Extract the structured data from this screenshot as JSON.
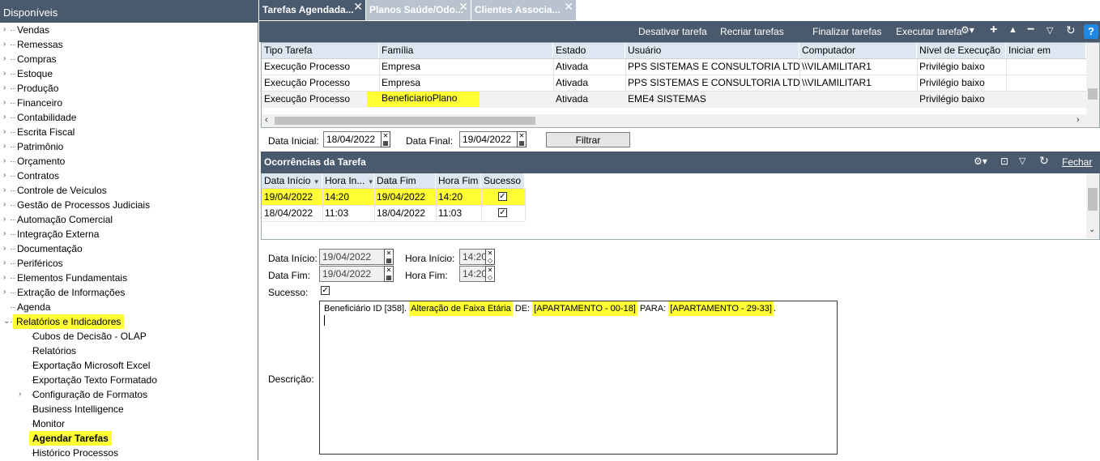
{
  "sidebar": {
    "title": "Disponíveis",
    "items": [
      {
        "label": "Vendas",
        "level": 0,
        "expandable": true
      },
      {
        "label": "Remessas",
        "level": 0,
        "expandable": true
      },
      {
        "label": "Compras",
        "level": 0,
        "expandable": true
      },
      {
        "label": "Estoque",
        "level": 0,
        "expandable": true
      },
      {
        "label": "Produção",
        "level": 0,
        "expandable": true
      },
      {
        "label": "Financeiro",
        "level": 0,
        "expandable": true
      },
      {
        "label": "Contabilidade",
        "level": 0,
        "expandable": true
      },
      {
        "label": "Escrita Fiscal",
        "level": 0,
        "expandable": true
      },
      {
        "label": "Patrimônio",
        "level": 0,
        "expandable": true
      },
      {
        "label": "Orçamento",
        "level": 0,
        "expandable": true
      },
      {
        "label": "Contratos",
        "level": 0,
        "expandable": true
      },
      {
        "label": "Controle de Veículos",
        "level": 0,
        "expandable": true
      },
      {
        "label": "Gestão de Processos Judiciais",
        "level": 0,
        "expandable": true
      },
      {
        "label": "Automação Comercial",
        "level": 0,
        "expandable": true
      },
      {
        "label": "Integração Externa",
        "level": 0,
        "expandable": true
      },
      {
        "label": "Documentação",
        "level": 0,
        "expandable": true
      },
      {
        "label": "Periféricos",
        "level": 0,
        "expandable": true
      },
      {
        "label": "Elementos Fundamentais",
        "level": 0,
        "expandable": true
      },
      {
        "label": "Extração de Informações",
        "level": 0,
        "expandable": true
      },
      {
        "label": "Agenda",
        "level": 0,
        "expandable": false
      },
      {
        "label": "Relatórios e Indicadores",
        "level": 0,
        "expandable": true,
        "expanded": true,
        "highlight": true
      },
      {
        "label": "Cubos de Decisão - OLAP",
        "level": 1
      },
      {
        "label": "Relatórios",
        "level": 1
      },
      {
        "label": "Exportação Microsoft Excel",
        "level": 1
      },
      {
        "label": "Exportação Texto Formatado",
        "level": 1
      },
      {
        "label": "Configuração de Formatos",
        "level": 1,
        "expandable": true
      },
      {
        "label": "Business Intelligence",
        "level": 1
      },
      {
        "label": "Monitor",
        "level": 1
      },
      {
        "label": "Agendar Tarefas",
        "level": 1,
        "highlight": true,
        "bold": true
      },
      {
        "label": "Histórico Processos",
        "level": 1
      }
    ]
  },
  "tabs": [
    {
      "label": "Tarefas Agendada...",
      "active": true
    },
    {
      "label": "Planos Saúde/Odo...",
      "active": false
    },
    {
      "label": "Clientes Associa...",
      "active": false
    }
  ],
  "toolbar": {
    "deactivate": "Desativar tarefa",
    "recreate": "Recriar tarefas",
    "finalize": "Finalizar tarefas",
    "execute": "Executar tarefa"
  },
  "tasks_grid": {
    "headers": [
      "Tipo Tarefa",
      "Família",
      "Estado",
      "Usuário",
      "Computador",
      "Nível de Execução",
      "Iniciar em"
    ],
    "rows": [
      [
        "Execução Processo",
        "Empresa",
        "Ativada",
        "PPS SISTEMAS E CONSULTORIA LTD",
        "\\\\VILAMILITAR1",
        "Privilégio baixo",
        ""
      ],
      [
        "Execução Processo",
        "Empresa",
        "Ativada",
        "PPS SISTEMAS E CONSULTORIA LTD",
        "\\\\VILAMILITAR1",
        "Privilégio baixo",
        ""
      ],
      [
        "Execução Processo",
        "BeneficiarioPlano",
        "Ativada",
        "EME4 SISTEMAS",
        "",
        "Privilégio baixo",
        ""
      ]
    ]
  },
  "filter": {
    "start_label": "Data Inicial:",
    "start_value": "18/04/2022",
    "end_label": "Data Final:",
    "end_value": "19/04/2022",
    "button": "Filtrar"
  },
  "occurrences": {
    "title": "Ocorrências da Tarefa",
    "close": "Fechar",
    "headers": [
      "Data Início",
      "Hora In...",
      "Data Fim",
      "Hora Fim",
      "Sucesso"
    ],
    "rows": [
      {
        "data_inicio": "19/04/2022",
        "hora_inicio": "14:20",
        "data_fim": "19/04/2022",
        "hora_fim": "14:20",
        "sucesso": true
      },
      {
        "data_inicio": "18/04/2022",
        "hora_inicio": "11:03",
        "data_fim": "18/04/2022",
        "hora_fim": "11:03",
        "sucesso": true
      }
    ]
  },
  "detail": {
    "data_inicio_label": "Data Início:",
    "data_inicio": "19/04/2022",
    "hora_inicio_label": "Hora Início:",
    "hora_inicio": "14:20",
    "data_fim_label": "Data Fim:",
    "data_fim": "19/04/2022",
    "hora_fim_label": "Hora Fim:",
    "hora_fim": "14:20",
    "sucesso_label": "Sucesso:",
    "sucesso": true,
    "descricao_label": "Descrição:",
    "descricao_parts": [
      "Beneficiário ID [358]. ",
      "Alteração de Faixa Etária",
      " DE: ",
      "[APARTAMENTO - 00-18]",
      " PARA: ",
      "[APARTAMENTO - 29-33]",
      "."
    ]
  },
  "colors": {
    "header_bg": "#4a5a6e",
    "highlight": "#ffff33",
    "grid_header": "#dde7f2",
    "help_icon": "#1e88e5"
  }
}
